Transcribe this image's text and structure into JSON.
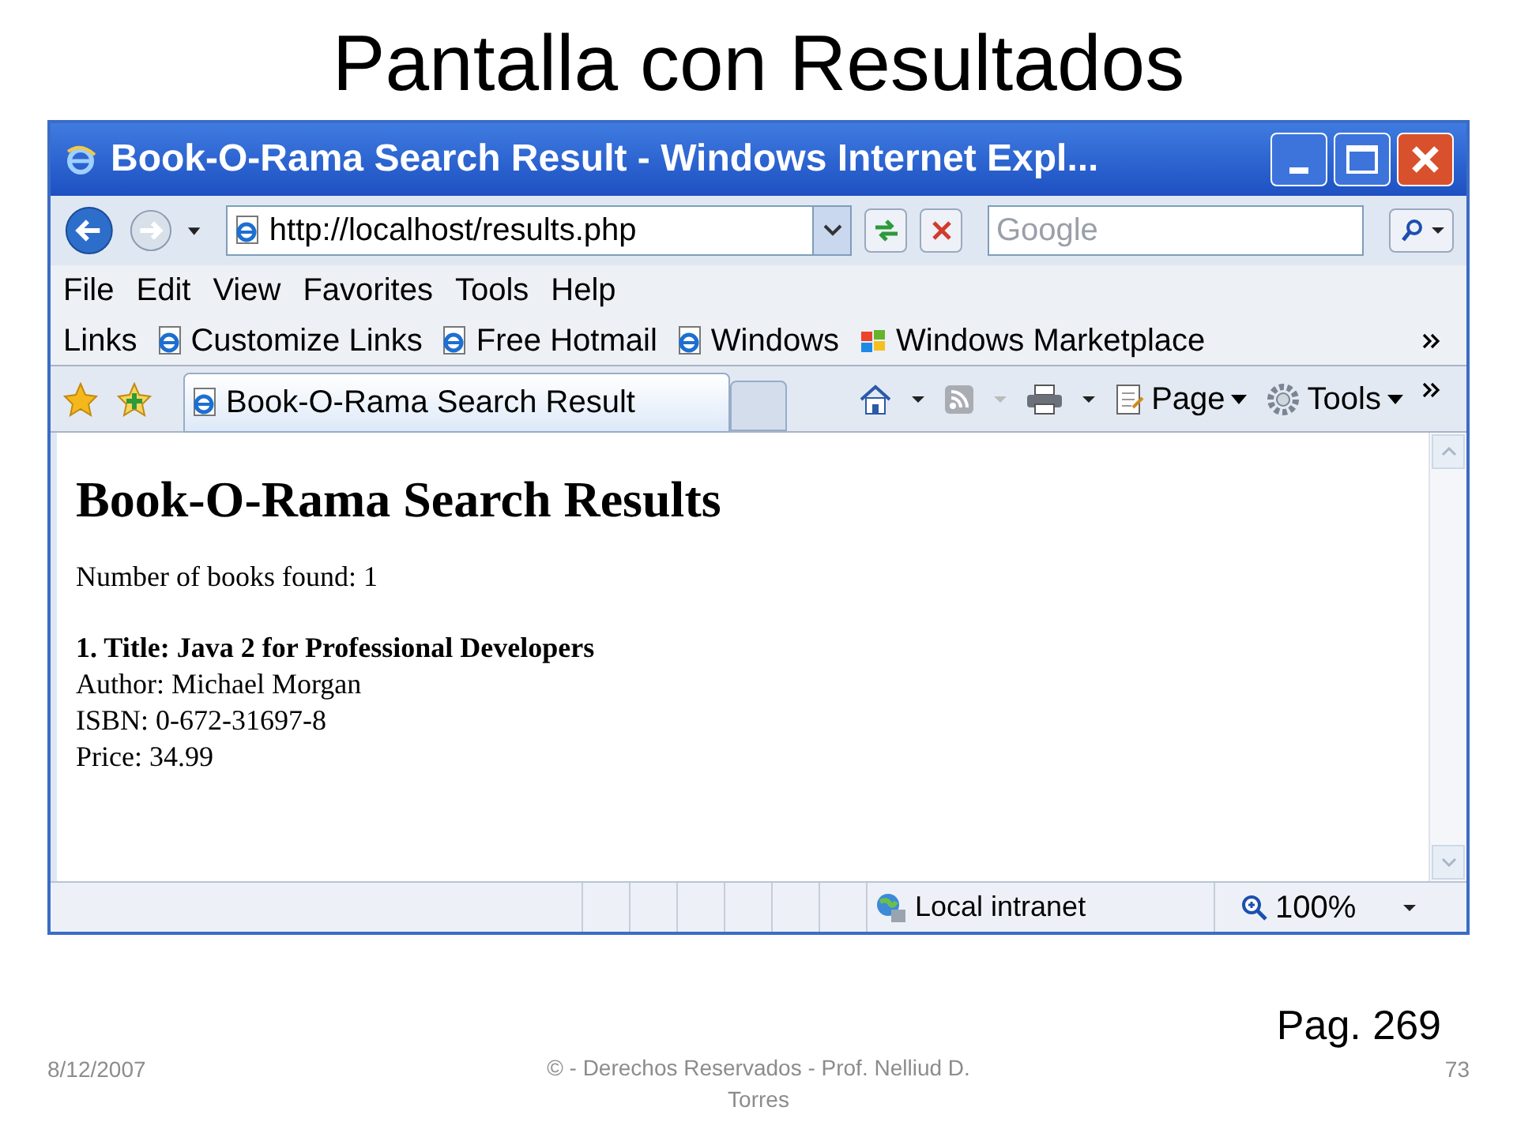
{
  "slide": {
    "title": "Pantalla con Resultados",
    "page_ref": "Pag. 269",
    "footer": {
      "date": "8/12/2007",
      "credit": "© - Derechos Reservados  - Prof. Nelliud D. Torres",
      "number": "73"
    }
  },
  "browser": {
    "window_title": "Book-O-Rama Search Result - Windows Internet Expl...",
    "address": "http://localhost/results.php",
    "search_placeholder": "Google",
    "menu": [
      "File",
      "Edit",
      "View",
      "Favorites",
      "Tools",
      "Help"
    ],
    "links_label": "Links",
    "links": [
      {
        "label": "Customize Links",
        "kind": "page"
      },
      {
        "label": "Free Hotmail",
        "kind": "page"
      },
      {
        "label": "Windows",
        "kind": "page"
      },
      {
        "label": "Windows Marketplace",
        "kind": "flag"
      }
    ],
    "tab": {
      "label": "Book-O-Rama Search Result"
    },
    "commands": [
      "Page",
      "Tools"
    ],
    "page": {
      "heading": "Book-O-Rama Search Results",
      "count": "Number of books found: 1",
      "result_title": "1. Title: Java 2 for Professional Developers",
      "lines": [
        "Author: Michael Morgan",
        "ISBN: 0-672-31697-8",
        "Price: 34.99"
      ]
    },
    "status": {
      "zone": "Local intranet",
      "zoom": "100%"
    }
  }
}
